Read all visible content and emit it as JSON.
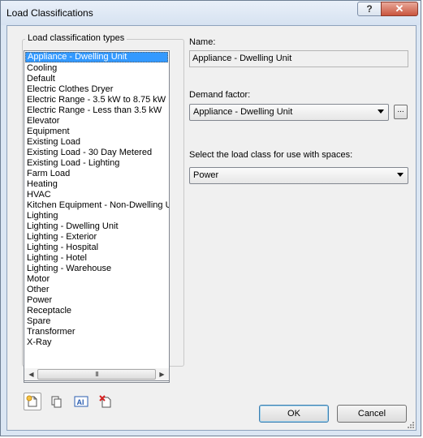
{
  "window": {
    "title": "Load Classifications",
    "help_label": "?",
    "close_label": "✕"
  },
  "list": {
    "title": "Load classification types",
    "selected_index": 0,
    "items": [
      "Appliance - Dwelling Unit",
      "Cooling",
      "Default",
      "Electric Clothes Dryer",
      "Electric Range - 3.5 kW to 8.75 kW",
      "Electric Range - Less than 3.5 kW",
      "Elevator",
      "Equipment",
      "Existing Load",
      "Existing Load - 30 Day Metered",
      "Existing Load - Lighting",
      "Farm Load",
      "Heating",
      "HVAC",
      "Kitchen Equipment - Non-Dwelling Unit",
      "Lighting",
      "Lighting - Dwelling Unit",
      "Lighting - Exterior",
      "Lighting - Hospital",
      "Lighting - Hotel",
      "Lighting - Warehouse",
      "Motor",
      "Other",
      "Power",
      "Receptacle",
      "Spare",
      "Transformer",
      "X-Ray"
    ],
    "scroll_left": "◀",
    "scroll_right": "▶",
    "scroll_grip": "III"
  },
  "toolbar": {
    "new_icon": "new-type-icon",
    "duplicate_icon": "duplicate-icon",
    "rename_icon": "rename-icon",
    "rename_glyph": "AI",
    "delete_icon": "delete-icon"
  },
  "form": {
    "name_label": "Name:",
    "name_value": "Appliance - Dwelling Unit",
    "demand_label": "Demand factor:",
    "demand_value": "Appliance - Dwelling Unit",
    "ellipsis_label": "...",
    "load_class_label": "Select the load class for use with spaces:",
    "load_class_value": "Power"
  },
  "buttons": {
    "ok": "OK",
    "cancel": "Cancel"
  },
  "colors": {
    "selection": "#3399ff",
    "client_bg": "#f0f0f0",
    "frame": "#dbe6f3",
    "close": "#c9553e"
  }
}
